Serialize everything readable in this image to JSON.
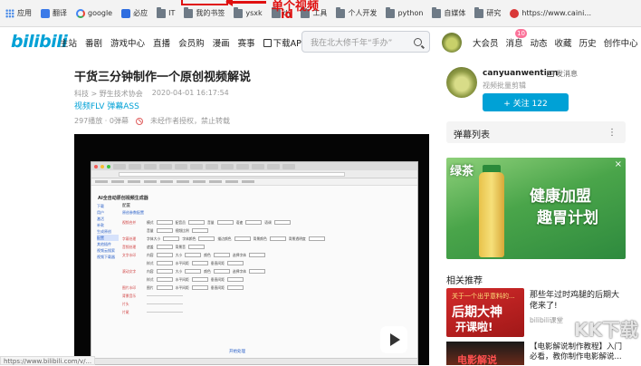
{
  "bookmarks": [
    {
      "icon": "apps-grid-icon",
      "label": "应用"
    },
    {
      "icon": "translate-icon",
      "label": "翻译"
    },
    {
      "icon": "google-icon",
      "label": "google"
    },
    {
      "icon": "bing-icon",
      "label": "必应"
    },
    {
      "icon": "folder-icon",
      "label": "IT"
    },
    {
      "icon": "folder-icon",
      "label": "我的书签"
    },
    {
      "icon": "folder-icon",
      "label": "ysxk"
    },
    {
      "icon": "folder-icon",
      "label": "dy"
    },
    {
      "icon": "folder-icon",
      "label": "工具"
    },
    {
      "icon": "folder-icon",
      "label": "个人开发"
    },
    {
      "icon": "folder-icon",
      "label": "python"
    },
    {
      "icon": "folder-icon",
      "label": "自媒体"
    },
    {
      "icon": "folder-icon",
      "label": "研究"
    },
    {
      "icon": "https-icon",
      "label": "https://www.caini..."
    }
  ],
  "annotation": {
    "line1": "单个视频",
    "line2": "id"
  },
  "header": {
    "logo": "bilibili",
    "nav": [
      "主站",
      "番剧",
      "游戏中心",
      "直播",
      "会员购",
      "漫画",
      "赛事"
    ],
    "download": "下载APP",
    "search_placeholder": "我在北大修千年“手办”",
    "user_nav": [
      "大会员",
      "消息",
      "动态",
      "收藏",
      "历史",
      "创作中心"
    ],
    "message_badge": "10"
  },
  "video": {
    "title": "干货三分钟制作一个原创视频解说",
    "category": "科技 > 野生技术协会",
    "publish_time": "2020-04-01 16:17:54",
    "links": "视频FLV 弹幕ASS",
    "play_count": "297播放 · 0弹幕",
    "copyright": "未经作者授权，禁止转载"
  },
  "inner_page": {
    "title": "AI全自动原创视频生成器",
    "side": [
      "下载",
      "用户",
      "激活",
      "补款",
      "生成原创",
      "配置",
      "其他插件",
      "视频云搜索",
      "视频下载器"
    ],
    "active_side": 5,
    "heading": "配置",
    "link": "原创参数配置",
    "rows": [
      {
        "label": "视频合并",
        "a": "模式",
        "b": "配音员",
        "c": "音量",
        "d": "语速",
        "e": "语调"
      },
      {
        "label": "",
        "a": "音量",
        "b": "视频比例",
        "c": "",
        "d": "",
        "e": ""
      },
      {
        "label": "字幕处理",
        "a": "字体大小",
        "b": "字体颜色",
        "c": "描边颜色",
        "d": "背景颜色",
        "e": "背景透明度"
      },
      {
        "label": "音频处理",
        "a": "遮盖",
        "b": "背景音",
        "c": "",
        "d": "",
        "e": ""
      },
      {
        "label": "文字水印",
        "a": "内容",
        "b": "大小",
        "c": "颜色",
        "d": "选择字体",
        "e": ""
      },
      {
        "label": "",
        "a": "样式",
        "b": "水平间距",
        "c": "垂直间距",
        "d": "",
        "e": ""
      },
      {
        "label": "滚动文字",
        "a": "内容",
        "b": "大小",
        "c": "颜色",
        "d": "选择字体",
        "e": ""
      },
      {
        "label": "",
        "a": "样式",
        "b": "水平间距",
        "c": "垂直间距",
        "d": "",
        "e": ""
      },
      {
        "label": "图片水印",
        "a": "图片",
        "b": "水平间距",
        "c": "垂直间距",
        "d": "",
        "e": ""
      },
      {
        "label": "背景音乐",
        "a": "",
        "b": "",
        "c": "",
        "d": "",
        "e": ""
      },
      {
        "label": "片头",
        "a": "",
        "b": "",
        "c": "",
        "d": "",
        "e": ""
      },
      {
        "label": "片尾",
        "a": "",
        "b": "",
        "c": "",
        "d": "",
        "e": ""
      }
    ],
    "start_button": "开始处理"
  },
  "status_url": "https://www.bilibili.com/v/...",
  "uploader": {
    "name": "canyuanwentian",
    "message": "发消息",
    "desc": "视频批量剪辑",
    "follow": "+ 关注 122"
  },
  "danmaku": {
    "title": "弹幕列表",
    "more": "⋮"
  },
  "ad": {
    "brand": "绿茶",
    "slogan1": "健康加盟",
    "slogan2": "趣胃计划",
    "close": "×"
  },
  "recommend": {
    "title": "相关推荐",
    "items": [
      {
        "thumb_line1": "关于一个出乎意料的...",
        "thumb_line2": "后期大神",
        "thumb_line3": "开课啦!",
        "title": "那些年过时鸡腿的后期大佬来了!",
        "up": "bilibili课堂"
      },
      {
        "thumb_line1": "电影解说",
        "title": "【电影解说制作教程】入门必看，教你制作电影解说..."
      }
    ]
  },
  "watermark": "KK下载",
  "colors": {
    "accent": "#00a1d6",
    "badge": "#fb7299",
    "annotation": "#e01010"
  }
}
